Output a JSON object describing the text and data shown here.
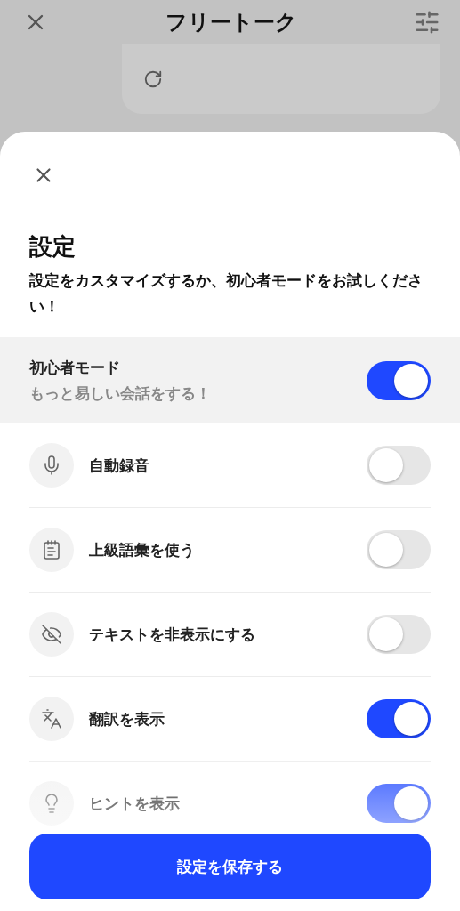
{
  "header": {
    "title": "フリートーク"
  },
  "sheet": {
    "title": "設定",
    "subtitle": "設定をカスタマイズするか、初心者モードをお試しください！"
  },
  "beginner_mode": {
    "label": "初心者モード",
    "description": "もっと易しい会話をする！",
    "on": true
  },
  "settings": [
    {
      "label": "自動録音",
      "on": false
    },
    {
      "label": "上級語彙を使う",
      "on": false
    },
    {
      "label": "テキストを非表示にする",
      "on": false
    },
    {
      "label": "翻訳を表示",
      "on": true
    },
    {
      "label": "ヒントを表示",
      "on": true
    }
  ],
  "save_button": "設定を保存する"
}
